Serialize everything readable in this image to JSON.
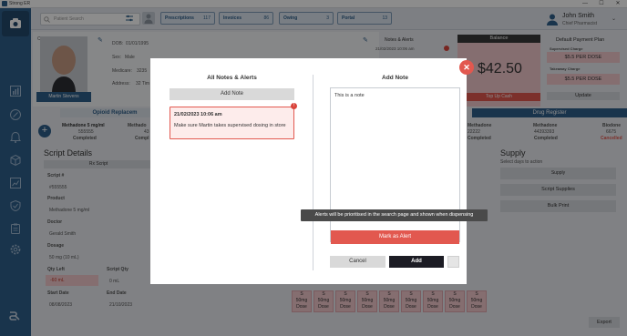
{
  "window": {
    "title": "Strong ER",
    "min": "—",
    "max": "☐",
    "close": "✕"
  },
  "topbar": {
    "search_placeholder": "Patient Search",
    "tabs": [
      {
        "label": "Prescriptions",
        "count": "117"
      },
      {
        "label": "Invoices",
        "count": "86"
      },
      {
        "label": "Owing",
        "count": "3"
      },
      {
        "label": "Portal",
        "count": "13"
      }
    ],
    "user_name": "John Smith",
    "user_role": "Chief Pharmacist"
  },
  "background": {
    "close_label": "Close",
    "patient_name": "Martin Stevens",
    "dob_label": "DOB:",
    "dob": "01/01/1995",
    "sex_label": "Sex:",
    "sex": "Male",
    "medicare_label": "Medicare:",
    "medicare": "3235",
    "address_label": "Address:",
    "address": "32 Tim",
    "notes_alerts": "Notes & Alerts",
    "notes_first_date": "21/02/2023 10:06 am",
    "balance_label": "Balance",
    "balance_value": "$42.50",
    "top_up": "Top Up Cash",
    "payment_plan": "Default Payment Plan",
    "supervised_charge": "Supervised Charge",
    "supervised_value": "$5.5 PER DOSE",
    "takeaway_charge": "Takeaway Charge",
    "takeaway_value": "$5.5 PER DOSE",
    "update": "Update",
    "opioid": "Opioid Replacem",
    "drug_register": "Drug Register",
    "med1": "Methadone 5 mg/ml",
    "med1_id": "555555",
    "med1_status": "Completed",
    "med1b": "Methado",
    "med1b_id": "43",
    "med1b_status": "Compl",
    "med2": "Methadone",
    "med2_id": "22222",
    "med2_status": "Completed",
    "med3": "Methadone",
    "med3_id": "44393393",
    "med3_status": "Completed",
    "med4": "Biodone",
    "med4_id": "6675",
    "med4_status": "Cancelled",
    "script_details": "Script Details",
    "rx_button": "Rx Script",
    "script_label": "Script #",
    "script_value": "#555555",
    "product_label": "Product",
    "product_value": "Methadone 5 mg/ml",
    "doctor_label": "Doctor",
    "doctor_value": "Gerald Smith",
    "dosage_label": "Dosage",
    "dosage_value": "50 mg (10 mL)",
    "qty_left_label": "Qty Left",
    "qty_left_value": "-60 mL",
    "script_qty_label": "Script Qty",
    "script_qty_value": "0 mL",
    "start_label": "Start Date",
    "start_value": "08/08/2023",
    "end_label": "End Date",
    "end_value": "21/10/2023",
    "supply": "Supply",
    "supply_hint": "Select days to action",
    "supply_btn1": "Supply",
    "script_supplies": "Script Supplies",
    "bulk_print": "Bulk Print",
    "export": "Export",
    "cell_s": "S",
    "cell_mg": "50mg",
    "cell_dose": "Dose"
  },
  "modal": {
    "left_title": "All Notes & Alerts",
    "add_note_button": "Add Note",
    "note": {
      "date": "21/02/2023 10:06 am",
      "text": "Make sure Martin takes supervised dosing in store",
      "badge": "!"
    },
    "right_title": "Add Note",
    "note_value": "This is a note",
    "tooltip": "Alerts will be prioritised in the search page and shown when dispensing",
    "mark_alert": "Mark as Alert",
    "cancel": "Cancel",
    "add": "Add",
    "close": "✕"
  },
  "colors": {
    "primary": "#2f5f8a",
    "danger": "#e2584f",
    "dark": "#1c1c24"
  }
}
